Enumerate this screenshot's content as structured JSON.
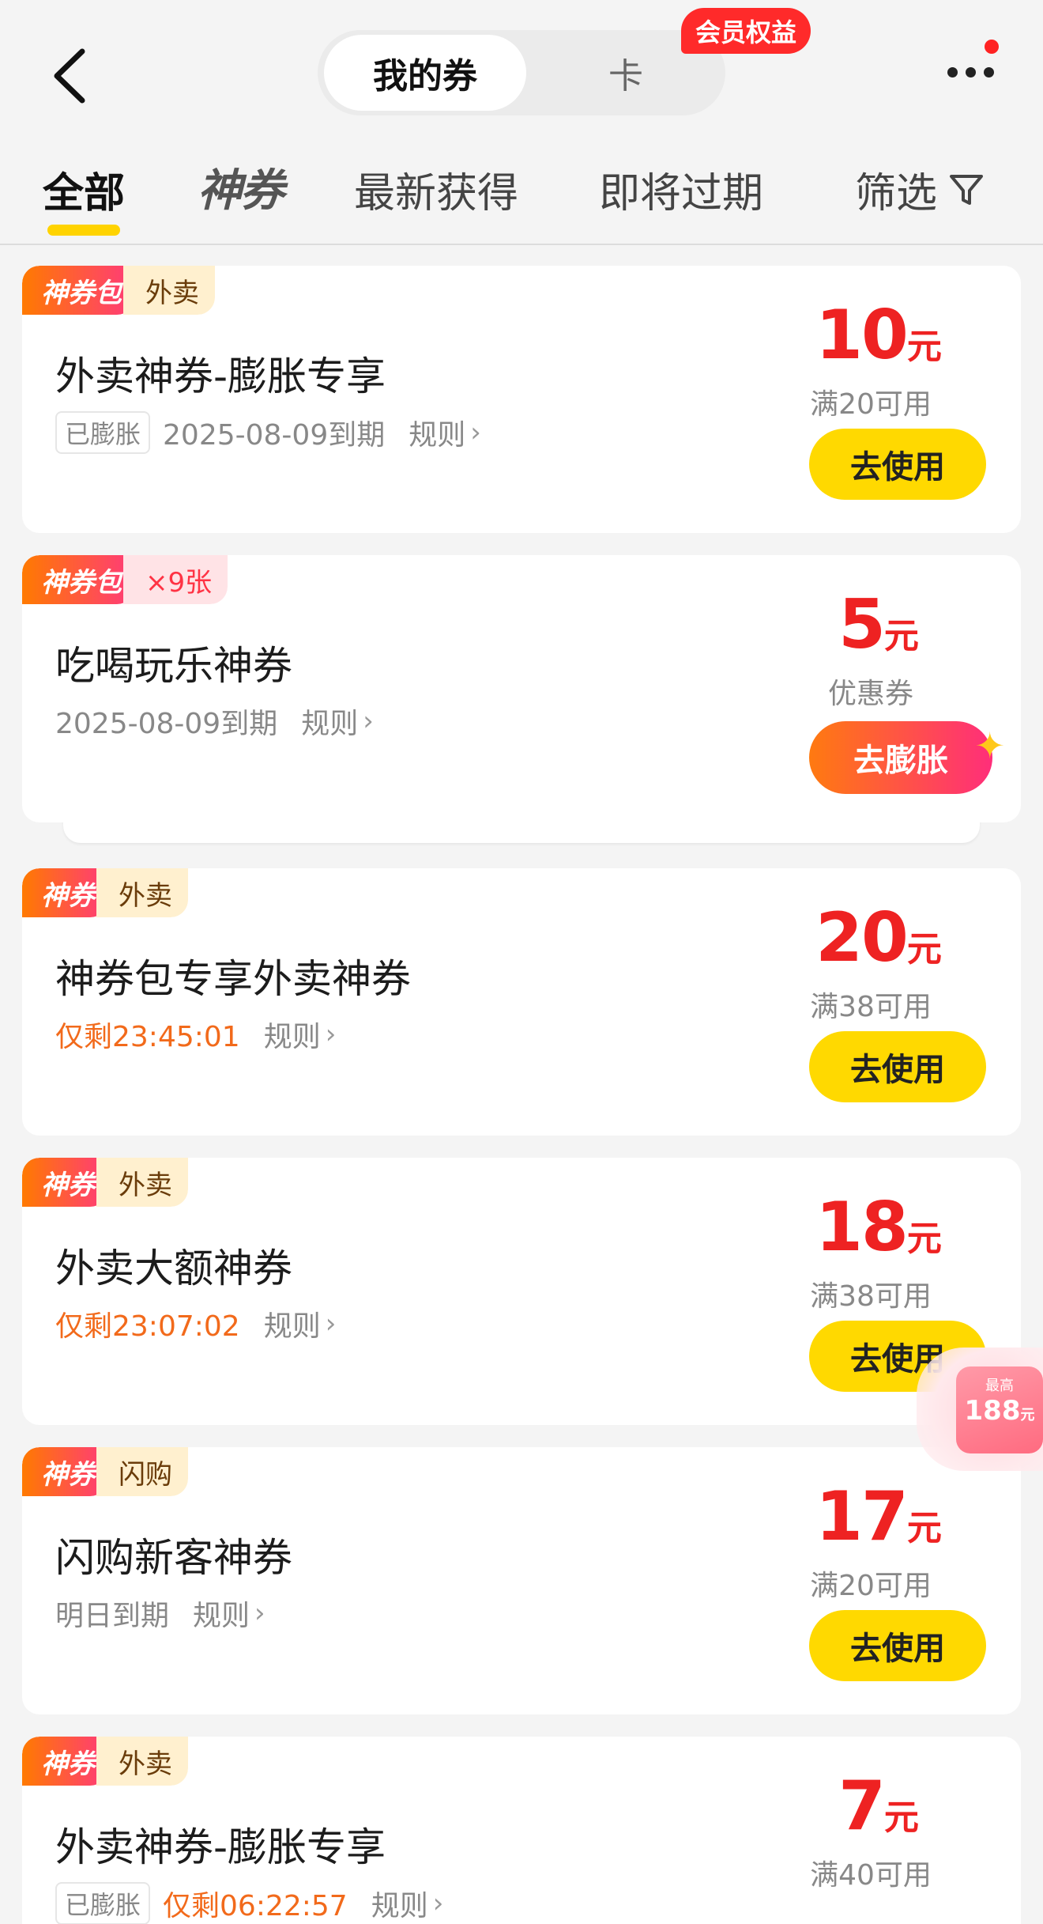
{
  "header": {
    "segment_active": "我的券",
    "segment_card": "卡",
    "vip_badge": "会员权益"
  },
  "tabs": {
    "all": "全部",
    "shenquan_logo": "神券",
    "recent": "最新获得",
    "expiring": "即将过期",
    "filter": "筛选"
  },
  "coupons": [
    {
      "tag_main": "神券包",
      "tag_sub": "外卖",
      "title": "外卖神券-膨胀专享",
      "chip": "已膨胀",
      "expiry": "2025-08-09到期",
      "rule": "规则",
      "amount": "10",
      "unit": "元",
      "condition": "满20可用",
      "button": "去使用"
    },
    {
      "tag_main": "神券包",
      "tag_sub": "×9张",
      "title": "吃喝玩乐神券",
      "expiry": "2025-08-09到期",
      "rule": "规则",
      "amount": "5",
      "unit": "元",
      "condition": "优惠券",
      "button": "去膨胀"
    },
    {
      "tag_main": "神券",
      "tag_sub": "外卖",
      "title": "神券包专享外卖神券",
      "countdown": "仅剩23:45:01",
      "rule": "规则",
      "amount": "20",
      "unit": "元",
      "condition": "满38可用",
      "button": "去使用"
    },
    {
      "tag_main": "神券",
      "tag_sub": "外卖",
      "title": "外卖大额神券",
      "countdown": "仅剩23:07:02",
      "rule": "规则",
      "amount": "18",
      "unit": "元",
      "condition": "满38可用",
      "button": "去使用"
    },
    {
      "tag_main": "神券",
      "tag_sub": "闪购",
      "title": "闪购新客神券",
      "expiry": "明日到期",
      "rule": "规则",
      "amount": "17",
      "unit": "元",
      "condition": "满20可用",
      "button": "去使用"
    },
    {
      "tag_main": "神券",
      "tag_sub": "外卖",
      "title": "外卖神券-膨胀专享",
      "chip": "已膨胀",
      "countdown": "仅剩06:22:57",
      "rule": "规则",
      "amount": "7",
      "unit": "元",
      "condition": "满40可用"
    }
  ],
  "float_promo": {
    "top_text": "最高",
    "amount": "188",
    "unit": "元"
  },
  "colors": {
    "accent_yellow": "#ffd900",
    "price_red": "#ee2222",
    "countdown_orange": "#f26a1b"
  },
  "icons": [
    "back-arrow-icon",
    "more-dots-icon",
    "filter-funnel-icon",
    "chevron-right-icon",
    "sparkle-icon"
  ]
}
